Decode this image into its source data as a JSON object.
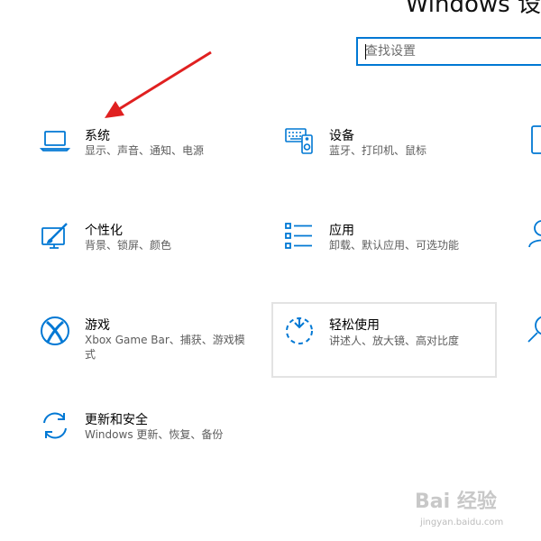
{
  "window": {
    "title": "Windows 设"
  },
  "search": {
    "placeholder": "查找设置"
  },
  "accent_color": "#0078d4",
  "categories": [
    {
      "icon": "laptop-icon",
      "title": "系统",
      "desc": "显示、声音、通知、电源"
    },
    {
      "icon": "devices-icon",
      "title": "设备",
      "desc": "蓝牙、打印机、鼠标"
    },
    {
      "icon": "personalization-icon",
      "title": "个性化",
      "desc": "背景、锁屏、颜色"
    },
    {
      "icon": "apps-icon",
      "title": "应用",
      "desc": "卸载、默认应用、可选功能"
    },
    {
      "icon": "xbox-icon",
      "title": "游戏",
      "desc": "Xbox Game Bar、捕获、游戏模式"
    },
    {
      "icon": "ease-of-access-icon",
      "title": "轻松使用",
      "desc": "讲述人、放大镜、高对比度"
    },
    {
      "icon": "update-icon",
      "title": "更新和安全",
      "desc": "Windows 更新、恢复、备份"
    }
  ],
  "watermark": {
    "logo": "Bai 经验",
    "url": "jingyan.baidu.com"
  }
}
